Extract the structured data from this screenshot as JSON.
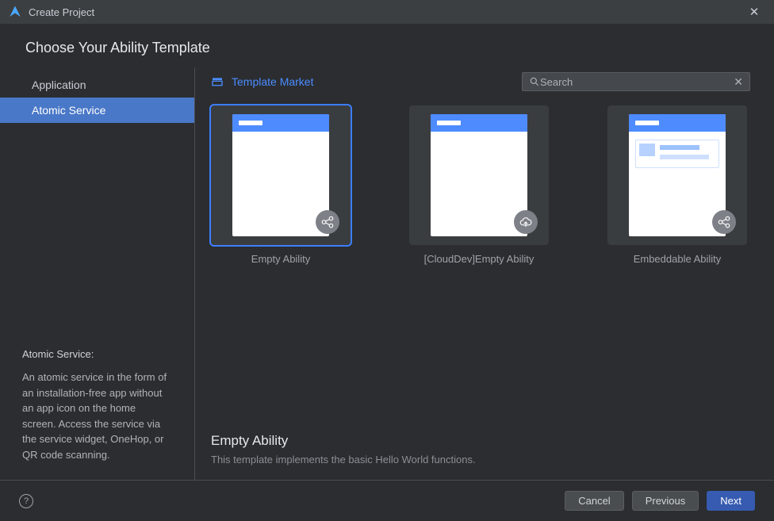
{
  "window": {
    "title": "Create Project"
  },
  "heading": "Choose Your Ability Template",
  "sidebar": {
    "items": [
      {
        "label": "Application",
        "active": false
      },
      {
        "label": "Atomic Service",
        "active": true
      }
    ],
    "desc_title": "Atomic Service:",
    "desc_body": "An atomic service in the form of an installation-free app without an app icon on the home screen. Access the service via the service widget, OneHop, or QR code scanning."
  },
  "market_link": "Template Market",
  "search": {
    "placeholder": "Search",
    "value": ""
  },
  "templates": [
    {
      "label": "Empty Ability",
      "selected": true,
      "kind": "empty"
    },
    {
      "label": "[CloudDev]Empty Ability",
      "selected": false,
      "kind": "cloud"
    },
    {
      "label": "Embeddable Ability",
      "selected": false,
      "kind": "embed"
    }
  ],
  "detail": {
    "title": "Empty Ability",
    "desc": "This template implements the basic Hello World functions."
  },
  "buttons": {
    "cancel": "Cancel",
    "previous": "Previous",
    "next": "Next"
  },
  "help_tooltip": "?"
}
